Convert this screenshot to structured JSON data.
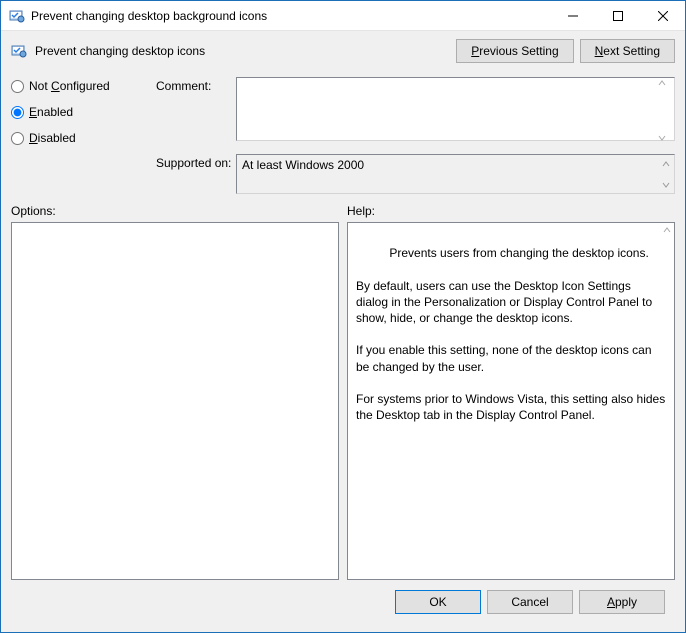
{
  "window": {
    "title": "Prevent changing desktop background icons"
  },
  "header": {
    "policy_title": "Prevent changing desktop icons"
  },
  "nav": {
    "prev_letter": "P",
    "prev_rest": "revious Setting",
    "next_letter": "N",
    "next_rest": "ext Setting"
  },
  "radios": {
    "not_configured": {
      "label": "Not Configured",
      "accesskey": "C"
    },
    "enabled": {
      "label": "Enabled",
      "accesskey": "E",
      "checked": true
    },
    "disabled": {
      "label": "Disabled",
      "accesskey": "D"
    }
  },
  "labels": {
    "comment": "Comment:",
    "supported_on": "Supported on:",
    "options": "Options:",
    "help": "Help:"
  },
  "comment": {
    "value": ""
  },
  "supported_on": {
    "value": "At least Windows 2000"
  },
  "options": {
    "text": ""
  },
  "help": {
    "text": "Prevents users from changing the desktop icons.\n\nBy default, users can use the Desktop Icon Settings dialog in the Personalization or Display Control Panel to show, hide, or change the desktop icons.\n\nIf you enable this setting, none of the desktop icons can be changed by the user.\n\nFor systems prior to Windows Vista, this setting also hides the Desktop tab in the Display Control Panel."
  },
  "footer": {
    "ok": "OK",
    "cancel": "Cancel",
    "apply_letter": "A",
    "apply_rest": "pply"
  }
}
